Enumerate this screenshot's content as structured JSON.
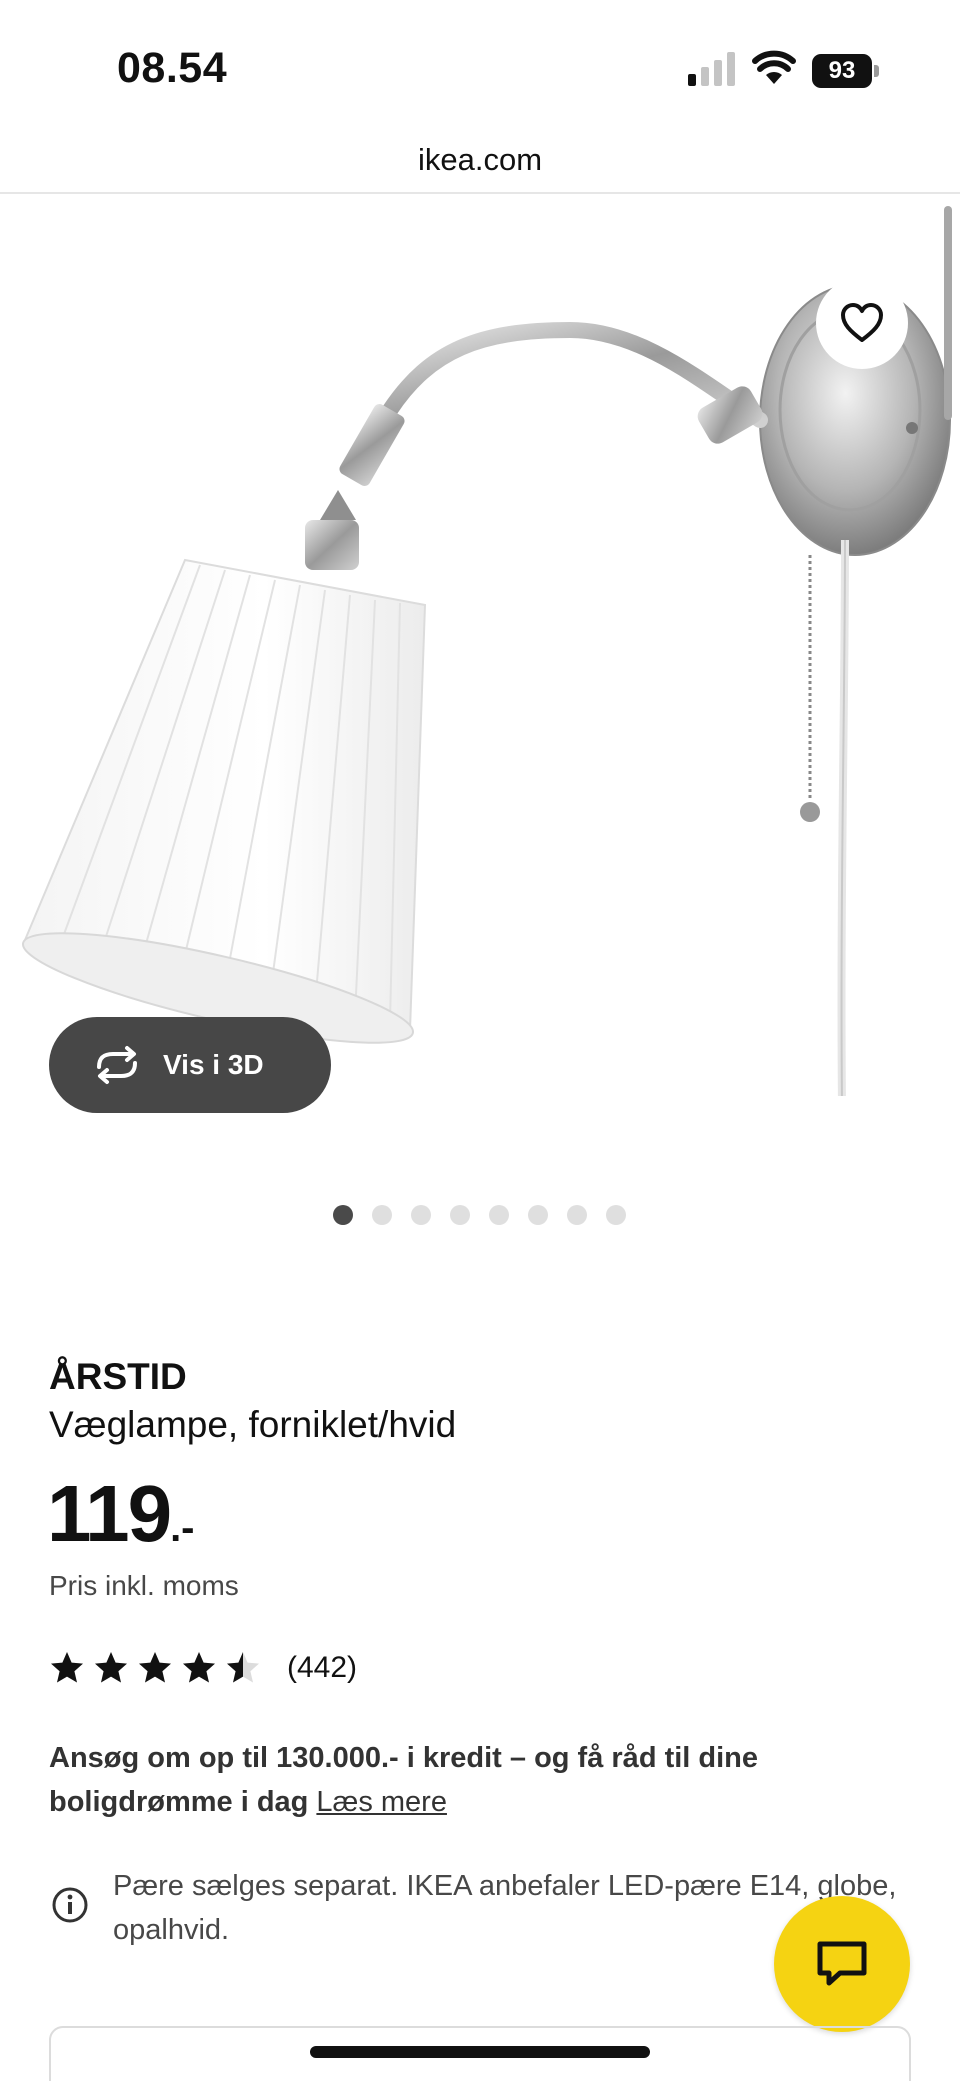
{
  "status_bar": {
    "time": "08.54",
    "battery": "93"
  },
  "url_bar": {
    "url": "ikea.com"
  },
  "gallery": {
    "view3d_label": "Vis i 3D",
    "dot_count": 8,
    "active_dot": 0
  },
  "product": {
    "name": "ÅRSTID",
    "description": "Væglampe, forniklet/hvid",
    "price": "119",
    "price_suffix": ".-",
    "price_note": "Pris inkl. moms",
    "rating_value": 4.5,
    "rating_max": 5,
    "review_count": "(442)"
  },
  "credit": {
    "text": "Ansøg om op til 130.000.- i kredit – og få råd til dine boligdrømme i dag",
    "link_label": "Læs mere"
  },
  "info": {
    "text": "Pære sælges separat. IKEA anbefaler LED-pære E14, globe, opalhvid."
  },
  "colors": {
    "chat_button": "#f5d312",
    "view3d_button": "#474747",
    "dot_active": "#4a4a4a",
    "dot_inactive": "#dfdfdf"
  }
}
